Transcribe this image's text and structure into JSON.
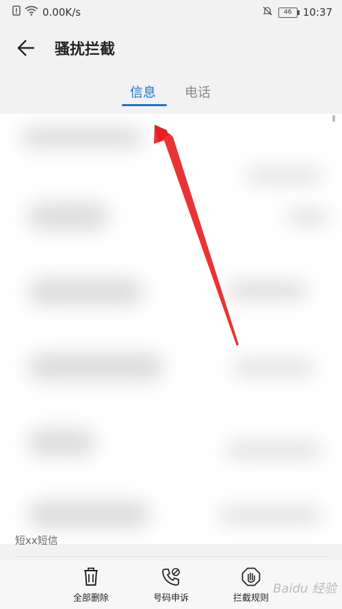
{
  "status_bar": {
    "network_speed": "0.00K/s",
    "battery_level": "46",
    "time": "10:37"
  },
  "header": {
    "title": "骚扰拦截"
  },
  "tabs": [
    {
      "label": "信息",
      "active": true
    },
    {
      "label": "电话",
      "active": false
    }
  ],
  "list": {
    "partial_text": "短xx短信"
  },
  "toolbar": {
    "delete_all": "全部删除",
    "number_appeal": "号码申诉",
    "block_rules": "拦截规则"
  },
  "watermark": "Baidu 经验",
  "colors": {
    "accent": "#1a73c8",
    "annotation_arrow": "#e61e1e"
  }
}
